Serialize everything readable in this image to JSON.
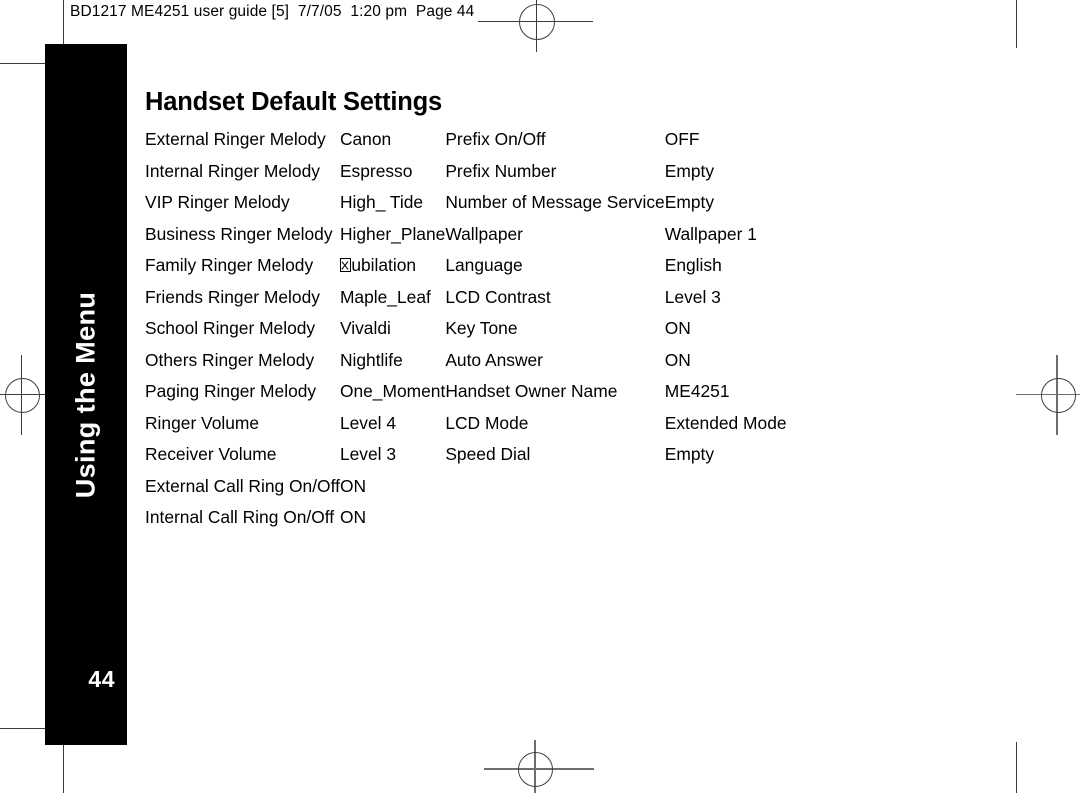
{
  "slug": "BD1217 ME4251 user guide [5]  7/7/05  1:20 pm  Page 44",
  "tab": {
    "label": "Using the Menu",
    "page_number": "44"
  },
  "title": "Handset Default Settings",
  "colors": {
    "tab_background": "#000000",
    "tab_text": "#ffffff",
    "body_text": "#000000",
    "page_background": "#ffffff",
    "crop_mark": "#6e6e6e"
  },
  "settings": {
    "left_column": [
      {
        "label": "External Ringer Melody",
        "value": "Canon"
      },
      {
        "label": "Internal Ringer Melody",
        "value": "Espresso"
      },
      {
        "label": "VIP Ringer Melody",
        "value": "High_ Tide"
      },
      {
        "label": "Business Ringer Melody",
        "value": "Higher_Plane"
      },
      {
        "label": "Family Ringer Melody",
        "value": "Jubilation",
        "value_glyph_missing": true
      },
      {
        "label": "Friends Ringer Melody",
        "value": "Maple_Leaf"
      },
      {
        "label": "School Ringer Melody",
        "value": "Vivaldi"
      },
      {
        "label": "Others Ringer Melody",
        "value": "Nightlife"
      },
      {
        "label": "Paging Ringer Melody",
        "value": "One_Moment"
      },
      {
        "label": "Ringer Volume",
        "value": "Level 4"
      },
      {
        "label": "Receiver Volume",
        "value": "Level 3"
      },
      {
        "label": "External Call Ring On/Off",
        "value": "ON"
      },
      {
        "label": "Internal Call Ring On/Off",
        "value": "ON"
      }
    ],
    "right_column": [
      {
        "label": "Prefix On/Off",
        "value": "OFF"
      },
      {
        "label": "Prefix Number",
        "value": "Empty"
      },
      {
        "label": "Number of Message Service",
        "value": "Empty"
      },
      {
        "label": "Wallpaper",
        "value": "Wallpaper 1"
      },
      {
        "label": "Language",
        "value": "English"
      },
      {
        "label": "LCD Contrast",
        "value": "Level 3"
      },
      {
        "label": "Key Tone",
        "value": "ON"
      },
      {
        "label": "Auto Answer",
        "value": "ON"
      },
      {
        "label": "Handset Owner Name",
        "value": "ME4251"
      },
      {
        "label": "LCD Mode",
        "value": "Extended Mode"
      },
      {
        "label": "Speed Dial",
        "value": "Empty"
      }
    ]
  }
}
